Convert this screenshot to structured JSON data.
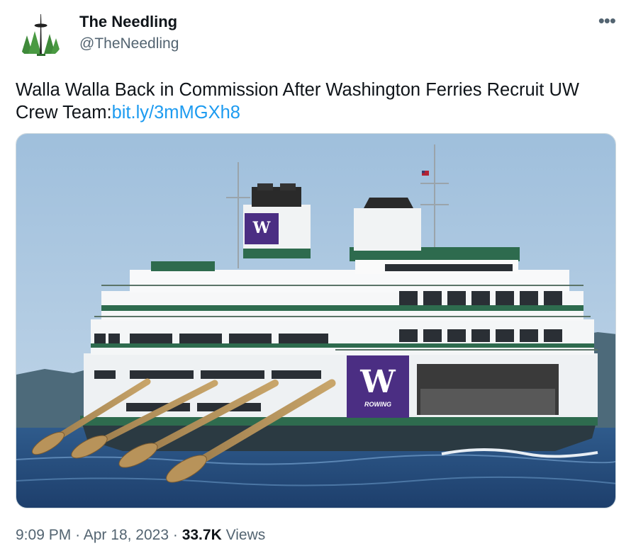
{
  "tweet": {
    "author": {
      "display_name": "The Needling",
      "handle": "@TheNeedling",
      "avatar_icon": "space-needle-forest-logo-icon"
    },
    "more_icon": "more-options-icon",
    "text": "Walla Walla Back in Commission After Washington Ferries Recruit UW Crew Team:",
    "link": "bit.ly/3mMGXh8",
    "media": {
      "description_icon": "ferry-with-oars-image",
      "logo_label": "ROWING"
    },
    "time": "9:09 PM",
    "separator": "·",
    "date": "Apr 18, 2023",
    "views_count": "33.7K",
    "views_label": "Views"
  },
  "colors": {
    "link": "#1d9bf0",
    "secondary_text": "#536471",
    "uw_purple": "#4b2e83",
    "ferry_green": "#2e6b4e"
  }
}
